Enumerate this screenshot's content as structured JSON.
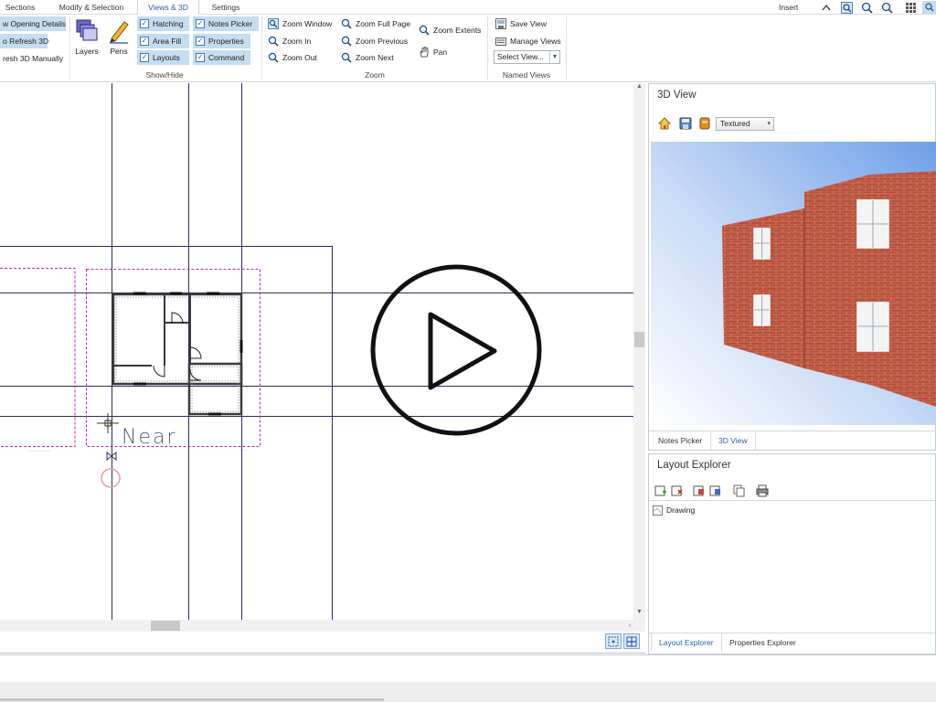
{
  "ribbon": {
    "tabs": [
      {
        "label": "Sections"
      },
      {
        "label": "Modify & Selection"
      },
      {
        "label": "Views & 3D"
      },
      {
        "label": "Settings"
      }
    ],
    "insert_label": "Insert",
    "left_buttons": {
      "opening_details": "w Opening Details",
      "auto_refresh": "o Refresh 3D",
      "refresh_manually": "resh 3D Manually"
    },
    "layers_label": "Layers",
    "pens_label": "Pens",
    "showhide": {
      "group_label": "Show/Hide",
      "hatching": "Hatching",
      "area_fill": "Area Fill",
      "layouts": "Layouts",
      "notes_picker": "Notes Picker",
      "properties": "Properties",
      "command": "Command"
    },
    "zoom": {
      "group_label": "Zoom",
      "window": "Zoom Window",
      "in": "Zoom In",
      "out": "Zoom Out",
      "full_page": "Zoom Full Page",
      "previous": "Zoom Previous",
      "next": "Zoom Next",
      "extents": "Zoom Extents",
      "pan": "Pan"
    },
    "named_views": {
      "group_label": "Named Views",
      "save_view": "Save View",
      "manage_views": "Manage Views",
      "select_view_placeholder": "Select View..."
    }
  },
  "canvas": {
    "annotation_text": "Near",
    "small_label_left": "...",
    "small_label_right": "..."
  },
  "panel_3d": {
    "title": "3D View",
    "render_mode": "Textured",
    "tabs": [
      {
        "label": "Notes Picker",
        "active": false
      },
      {
        "label": "3D View",
        "active": true
      }
    ]
  },
  "layout_explorer": {
    "title": "Layout Explorer",
    "tree": [
      {
        "label": "Drawing"
      }
    ],
    "tabs": [
      {
        "label": "Layout Explorer",
        "active": true
      },
      {
        "label": "Properties Explorer",
        "active": false
      }
    ]
  },
  "colors": {
    "accent": "#2a62ad",
    "highlight": "#c5dcf1",
    "brick": "#b8503a",
    "sky_top": "#6f9fe8",
    "drawing_line": "#2b2d5a",
    "layout_border": "#c020c0"
  }
}
